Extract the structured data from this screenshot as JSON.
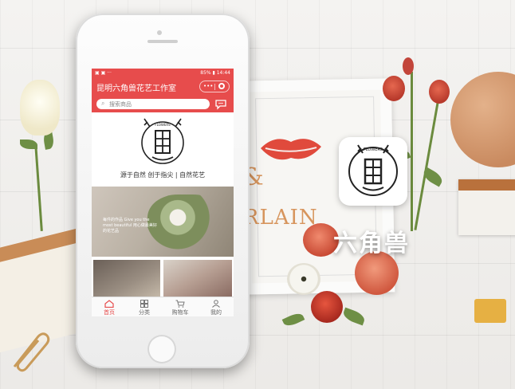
{
  "phone": {
    "statusbar": {
      "left": "▣ ▣ ··· ",
      "right": "85% ▮ 14:44"
    },
    "app_title": "昆明六角兽花艺工作室",
    "capsule": {
      "dots": "•••"
    },
    "search": {
      "placeholder": "搜索商品"
    },
    "tagline": "源于自然  创于指尖  |  自然花艺",
    "hero_caption": "每件的作品 Give you the most beautiful 用心做最美好的花艺品",
    "tabs": [
      {
        "label": "首页",
        "icon": "home-icon",
        "active": true
      },
      {
        "label": "分类",
        "icon": "grid-icon",
        "active": false
      },
      {
        "label": "购物车",
        "icon": "cart-icon",
        "active": false
      },
      {
        "label": "我的",
        "icon": "user-icon",
        "active": false
      }
    ]
  },
  "brand": {
    "name": "六角兽",
    "logo_text": "FLOWERS"
  },
  "poster": {
    "text": "RLAIN",
    "amp": "&"
  },
  "colors": {
    "accent": "#e74c4c"
  }
}
